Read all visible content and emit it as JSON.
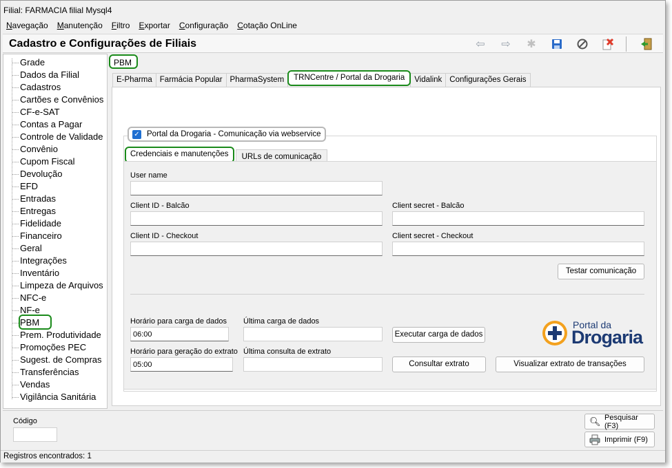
{
  "window": {
    "title": "Filial: FARMACIA filial Mysql4"
  },
  "menu": [
    {
      "u": "N",
      "rest": "avegação"
    },
    {
      "u": "M",
      "rest": "anutenção"
    },
    {
      "u": "F",
      "rest": "iltro"
    },
    {
      "u": "E",
      "rest": "xportar"
    },
    {
      "u": "C",
      "rest": "onfiguração"
    },
    {
      "u": "C",
      "rest": "otação OnLine"
    }
  ],
  "header": {
    "title": "Cadastro e Configurações de Filiais"
  },
  "toolbar": {
    "icons": [
      "back-arrow-icon",
      "forward-arrow-icon",
      "new-record-icon",
      "save-icon",
      "cancel-icon",
      "delete-icon",
      "exit-icon"
    ]
  },
  "tree": {
    "items": [
      "Grade",
      "Dados da Filial",
      "Cadastros",
      "Cartões e Convênios",
      "CF-e-SAT",
      "Contas a Pagar",
      "Controle de Validade",
      "Convênio",
      "Cupom Fiscal",
      "Devolução",
      "EFD",
      "Entradas",
      "Entregas",
      "Fidelidade",
      "Financeiro",
      "Geral",
      "Integrações",
      "Inventário",
      "Limpeza de Arquivos",
      "NFC-e",
      "NF-e",
      "PBM",
      "Prem. Produtividade",
      "Promoções PEC",
      "Sugest. de Compras",
      "Transferências",
      "Vendas",
      "Vigilância Sanitária"
    ]
  },
  "section_tab": "PBM",
  "tabs": [
    "E-Pharma",
    "Farmácia Popular",
    "PharmaSystem",
    "TRNCentre / Portal da Drogaria",
    "Vidalink",
    "Configurações Gerais"
  ],
  "checkbox": {
    "label": "Portal da Drogaria - Comunicação via webservice",
    "checked": true
  },
  "subtabs": [
    "Credenciais e manutenções",
    "URLs de comunicação"
  ],
  "form": {
    "user_name_label": "User name",
    "client_id_balcao_label": "Client ID - Balcão",
    "client_secret_balcao_label": "Client secret - Balcão",
    "client_id_checkout_label": "Client ID - Checkout",
    "client_secret_checkout_label": "Client secret - Checkout",
    "test_button": "Testar comunicação",
    "horario_carga_label": "Horário para carga de dados",
    "horario_carga_value": "06:00",
    "ultima_carga_label": "Última carga de dados",
    "exec_carga_button": "Executar carga de dados",
    "horario_extrato_label": "Horário para geração do extrato",
    "horario_extrato_value": "05:00",
    "ultima_consulta_label": "Última consulta de extrato",
    "consultar_button": "Consultar extrato",
    "visualizar_button": "Visualizar extrato de transações"
  },
  "logo": {
    "line1": "Portal da",
    "line2": "Drogaria"
  },
  "bottom": {
    "codigo_label": "Código",
    "search_button": "Pesquisar (F3)",
    "print_button": "Imprimir (F9)"
  },
  "status": "Registros encontrados: 1",
  "colors": {
    "highlight": "#1a8a1a",
    "accent": "#1f6fd1",
    "logo_blue": "#1c3a73",
    "logo_orange": "#f3a11e"
  }
}
